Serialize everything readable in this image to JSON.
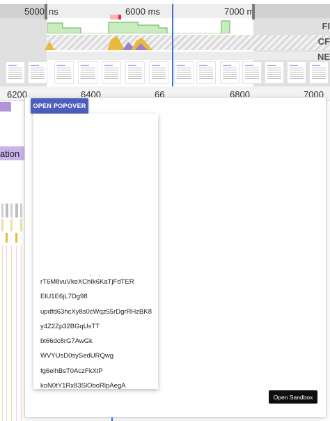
{
  "timeline": {
    "overview_ticks": [
      "5000",
      "ns",
      "6000 ms",
      "7000 m"
    ],
    "lanes": [
      "FI",
      "CF",
      "NE"
    ],
    "ruler_ticks": [
      "6200",
      "6400",
      "66",
      "6800",
      "7000"
    ],
    "flame_label": "ation"
  },
  "popover_demo": {
    "open_button_label": "OPEN POPOVER",
    "loading_indicator": ". .",
    "items": [
      "rT6M8vuVkeXChIk6KaTjFdTER",
      "ElU1E6jL7Dg98",
      "updfd63hcXy8s0cWqz55rDgrRHzBK8",
      "y4Z2Zp32BGqUsTT",
      "bt66dc8rG7AwGk",
      "WVYUsD0sySedURQwg",
      "fg6elhBsT0AczFkXtP",
      "koN0tY1Rx83SlOboRlpAegA"
    ],
    "open_sandbox_label": "Open Sandbox"
  },
  "colors": {
    "primary_button": "#4c5fbd",
    "sandbox_button": "#0e0e0e",
    "cursor_line": "#3f72d8",
    "flame_purple": "#c9b3ea"
  }
}
